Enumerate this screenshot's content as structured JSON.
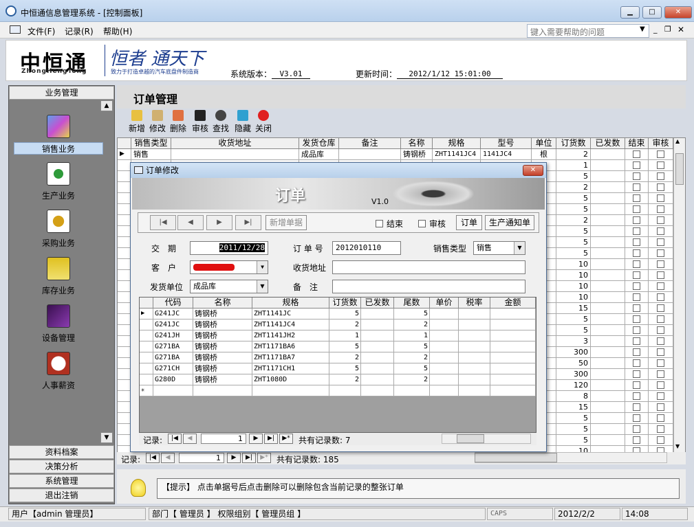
{
  "window": {
    "title": "中恒通信息管理系统 - [控制面板]"
  },
  "menu": {
    "file": "文件(F)",
    "record": "记录(R)",
    "help": "帮助(H)",
    "help_placeholder": "键入需要帮助的问题"
  },
  "header": {
    "logo": "中恒通",
    "logo_sub": "ZhongHengTong",
    "slogan": "恒者 通天下",
    "slogan_sub": "致力于打造卓越的汽车底盘件制造商",
    "version_label": "系统版本：",
    "version": "V3.01",
    "update_label": "更新时间：",
    "update_time": "2012/1/12 15:01:00"
  },
  "sidebar": {
    "top_header": "业务管理",
    "items": [
      {
        "label": "销售业务",
        "icon": "cubes-icon",
        "color": "#3a7bd5"
      },
      {
        "label": "生产业务",
        "icon": "molecule-icon",
        "color": "#2e9b3a"
      },
      {
        "label": "采购业务",
        "icon": "gears-icon",
        "color": "#d4a017"
      },
      {
        "label": "库存业务",
        "icon": "org-chart-icon",
        "color": "#e0c020"
      },
      {
        "label": "设备管理",
        "icon": "trend-chart-icon",
        "color": "#6a2a8a"
      },
      {
        "label": "人事薪资",
        "icon": "clock-icon",
        "color": "#b03020"
      }
    ],
    "bottom_headers": [
      "资料档案",
      "决策分析",
      "系统管理",
      "退出注销"
    ]
  },
  "main": {
    "title": "订单管理",
    "toolbar": [
      "新增",
      "修改",
      "删除",
      "审核",
      "查找",
      "隐藏",
      "关闭"
    ],
    "grid_headers": [
      "销售类型",
      "收货地址",
      "发货仓库",
      "备注",
      "名称",
      "规格",
      "型号",
      "单位",
      "订货数",
      "已发数",
      "结束",
      "审核"
    ],
    "first_row": {
      "type": "销售",
      "warehouse": "成品库",
      "name": "铸钢桥",
      "spec": "ZHT1141JC4",
      "model": "1141JC4",
      "unit": "根",
      "qty": "2"
    },
    "qty_column": [
      "1",
      "5",
      "2",
      "5",
      "5",
      "2",
      "5",
      "5",
      "5",
      "10",
      "10",
      "10",
      "10",
      "15",
      "5",
      "5",
      "3",
      "300",
      "50",
      "300",
      "120",
      "8",
      "15",
      "5",
      "5",
      "5",
      "10"
    ],
    "record_label": "记录:",
    "record_current": "1",
    "record_total": "共有记录数: 185"
  },
  "hint": {
    "text": "【提示】 点击单据号后点击删除可以删除包含当前记录的整张订单"
  },
  "status": {
    "user": "用户【admin 管理员】",
    "dept": "部门【 管理员 】 权限组别【 管理员组 】",
    "caps": "CAPS",
    "date": "2012/2/2",
    "time": "14:08"
  },
  "dialog": {
    "title": "订单修改",
    "banner_title": "订单",
    "banner_version": "V1.0",
    "new_doc": "新增单据",
    "chk_end": "结束",
    "chk_audit": "审核",
    "btn_order": "订单",
    "btn_production": "生产通知单",
    "labels": {
      "date": "交　期",
      "order_no": "订 单 号",
      "sales_type": "销售类型",
      "customer": "客　户",
      "address": "收货地址",
      "ship_unit": "发货单位",
      "remark": "备　注"
    },
    "values": {
      "date": "2011/12/28",
      "order_no": "2012010110",
      "sales_type": "销售",
      "ship_unit": "成品库",
      "address": "",
      "remark": ""
    },
    "grid_headers": [
      "代码",
      "名称",
      "规格",
      "订货数",
      "已发数",
      "尾数",
      "单价",
      "税率",
      "金额"
    ],
    "rows": [
      {
        "code": "G241JC",
        "name": "铸钢桥",
        "spec": "ZHT1141JC",
        "qty": "5",
        "tail": "5"
      },
      {
        "code": "G241JC",
        "name": "铸钢桥",
        "spec": "ZHT1141JC4",
        "qty": "2",
        "tail": "2"
      },
      {
        "code": "G241JH",
        "name": "铸钢桥",
        "spec": "ZHT1141JH2",
        "qty": "1",
        "tail": "1"
      },
      {
        "code": "G271BA",
        "name": "铸钢桥",
        "spec": "ZHT1171BA6",
        "qty": "5",
        "tail": "5"
      },
      {
        "code": "G271BA",
        "name": "铸钢桥",
        "spec": "ZHT1171BA7",
        "qty": "2",
        "tail": "2"
      },
      {
        "code": "G271CH",
        "name": "铸钢桥",
        "spec": "ZHT1171CH1",
        "qty": "5",
        "tail": "5"
      },
      {
        "code": "G280D",
        "name": "铸钢桥",
        "spec": "ZHT1080D",
        "qty": "2",
        "tail": "2"
      }
    ],
    "record_label": "记录:",
    "record_current": "1",
    "record_total": "共有记录数: 7"
  }
}
